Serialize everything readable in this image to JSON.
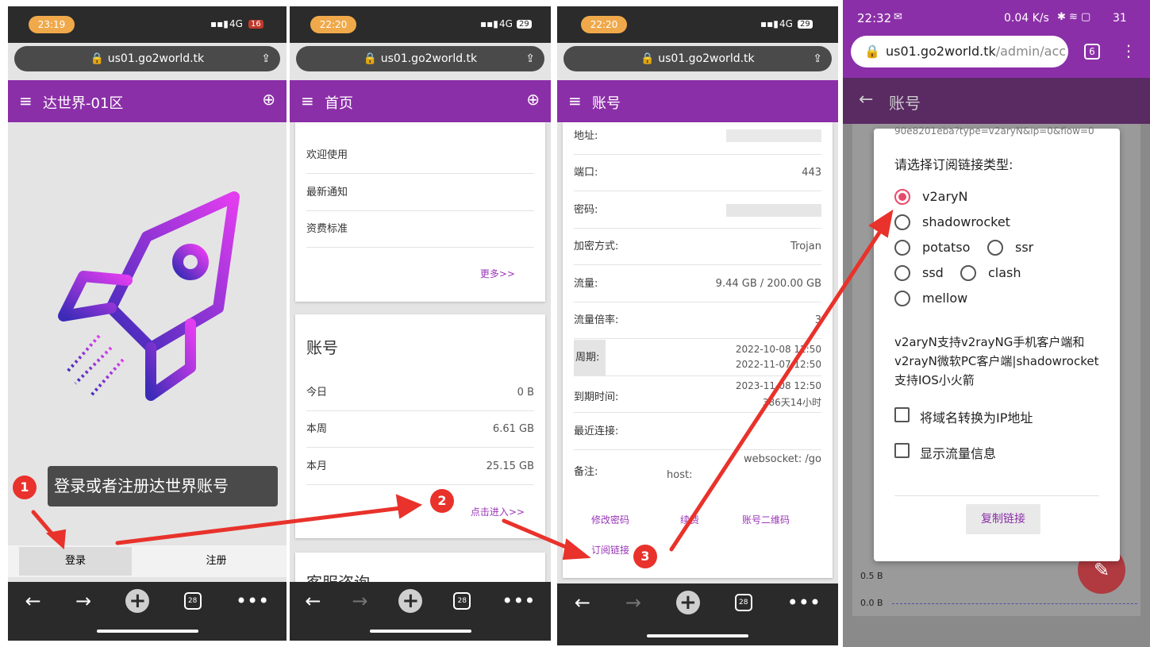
{
  "colors": {
    "purple": "#8b2fa8",
    "red_annotation": "#e8322b",
    "radio_selected": "#e84a6a"
  },
  "panel1": {
    "status_time": "23:19",
    "status_right": "4G",
    "battery": "16",
    "url": "us01.go2world.tk",
    "app_title": "达世界-01区",
    "callout": "登录或者注册达世界账号",
    "login": "登录",
    "register": "注册",
    "tab_count": "28",
    "step": "1"
  },
  "panel2": {
    "status_time": "22:20",
    "status_right": "4G",
    "battery": "29",
    "url": "us01.go2world.tk",
    "app_title": "首页",
    "menu_items": [
      "欢迎使用",
      "最新通知",
      "资费标准"
    ],
    "more": "更多>>",
    "account_title": "账号",
    "account_rows": [
      {
        "label": "今日",
        "value": "0 B"
      },
      {
        "label": "本周",
        "value": "6.61 GB"
      },
      {
        "label": "本月",
        "value": "25.15 GB"
      }
    ],
    "enter_link": "点击进入>>",
    "service_title": "客服咨询",
    "tab_count": "28",
    "step": "2"
  },
  "panel3": {
    "status_time": "22:20",
    "status_right": "4G",
    "battery": "29",
    "url": "us01.go2world.tk",
    "app_title": "账号",
    "rows": [
      {
        "label": "地址:",
        "value": "",
        "value2": ""
      },
      {
        "label": "端口:",
        "value": "443",
        "value2": ""
      },
      {
        "label": "密码:",
        "value": "",
        "value2": ""
      },
      {
        "label": "加密方式:",
        "value": "Trojan",
        "value2": ""
      },
      {
        "label": "流量:",
        "value": "9.44 GB / 200.00 GB",
        "value2": ""
      },
      {
        "label": "流量倍率:",
        "value": "3",
        "value2": ""
      },
      {
        "label": "周期:",
        "value": "2022-10-08 12:50",
        "value2": "2022-11-07 12:50"
      },
      {
        "label": "到期时间:",
        "value": "2023-11-08 12:50",
        "value2": "386天14小时"
      },
      {
        "label": "最近连接:",
        "value": "",
        "value2": ""
      },
      {
        "label": "备注:",
        "value": "websocket: /go",
        "value2": "host:"
      }
    ],
    "links": [
      "修改密码",
      "续费",
      "账号二维码"
    ],
    "subscribe": "订阅链接",
    "tab_count": "28",
    "step": "3"
  },
  "panel4": {
    "status_time": "22:32",
    "status_right": "0.04 K/s",
    "battery": "31",
    "url_main": "us01.go2world.tk",
    "url_path": "/admin/acc",
    "tab_count": "6",
    "app_title": "账号",
    "top_snippet": "90e8201eba?type=v2aryN&ip=0&flow=0",
    "dialog_title": "请选择订阅链接类型:",
    "options": [
      "v2aryN",
      "shadowrocket",
      "potatso",
      "ssr",
      "ssd",
      "clash",
      "mellow"
    ],
    "selected": "v2aryN",
    "description": "v2aryN支持v2rayNG手机客户端和v2rayN微软PC客户端|shadowrocket支持IOS小火箭",
    "checkbox1": "将域名转换为IP地址",
    "checkbox2": "显示流量信息",
    "copy_button": "复制链接",
    "y_tick1": "0.5 B",
    "y_tick2": "0.0 B"
  }
}
